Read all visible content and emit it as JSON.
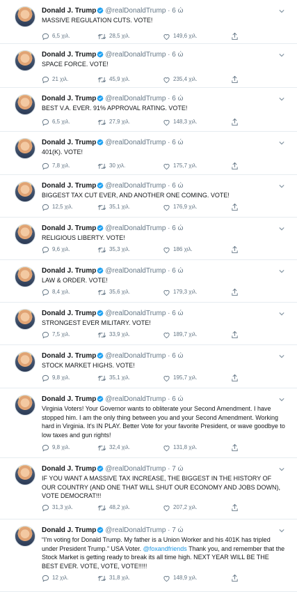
{
  "feed": {
    "tweets": [
      {
        "name": "Donald J. Trump",
        "handle": "@realDonaldTrump",
        "dot": "·",
        "time": "6 ώ",
        "text": "MASSIVE REGULATION CUTS. VOTE!",
        "replies": "6,5 χιλ.",
        "retweets": "28,5 χιλ.",
        "likes": "149,6 χιλ."
      },
      {
        "name": "Donald J. Trump",
        "handle": "@realDonaldTrump",
        "dot": "·",
        "time": "6 ώ",
        "text": "SPACE FORCE. VOTE!",
        "replies": "21 χιλ.",
        "retweets": "45,9 χιλ.",
        "likes": "235,4 χιλ."
      },
      {
        "name": "Donald J. Trump",
        "handle": "@realDonaldTrump",
        "dot": "·",
        "time": "6 ώ",
        "text": "BEST V.A. EVER. 91% APPROVAL RATING. VOTE!",
        "replies": "6,5 χιλ.",
        "retweets": "27,9 χιλ.",
        "likes": "148,3 χιλ."
      },
      {
        "name": "Donald J. Trump",
        "handle": "@realDonaldTrump",
        "dot": "·",
        "time": "6 ώ",
        "text": "401(K). VOTE!",
        "replies": "7,8 χιλ.",
        "retweets": "30 χιλ.",
        "likes": "175,7 χιλ."
      },
      {
        "name": "Donald J. Trump",
        "handle": "@realDonaldTrump",
        "dot": "·",
        "time": "6 ώ",
        "text": "BIGGEST TAX CUT EVER, AND ANOTHER ONE COMING. VOTE!",
        "replies": "12,5 χιλ.",
        "retweets": "35,1 χιλ.",
        "likes": "176,9 χιλ."
      },
      {
        "name": "Donald J. Trump",
        "handle": "@realDonaldTrump",
        "dot": "·",
        "time": "6 ώ",
        "text": "RELIGIOUS LIBERTY. VOTE!",
        "replies": "9,6 χιλ.",
        "retweets": "35,3 χιλ.",
        "likes": "186 χιλ."
      },
      {
        "name": "Donald J. Trump",
        "handle": "@realDonaldTrump",
        "dot": "·",
        "time": "6 ώ",
        "text": "LAW & ORDER. VOTE!",
        "replies": "8,4 χιλ.",
        "retweets": "35,6 χιλ.",
        "likes": "179,3 χιλ."
      },
      {
        "name": "Donald J. Trump",
        "handle": "@realDonaldTrump",
        "dot": "·",
        "time": "6 ώ",
        "text": "STRONGEST EVER MILITARY. VOTE!",
        "replies": "7,5 χιλ.",
        "retweets": "33,9 χιλ.",
        "likes": "189,7 χιλ."
      },
      {
        "name": "Donald J. Trump",
        "handle": "@realDonaldTrump",
        "dot": "·",
        "time": "6 ώ",
        "text": "STOCK MARKET HIGHS. VOTE!",
        "replies": "9,8 χιλ.",
        "retweets": "35,1 χιλ.",
        "likes": "195,7 χιλ."
      },
      {
        "name": "Donald J. Trump",
        "handle": "@realDonaldTrump",
        "dot": "·",
        "time": "6 ώ",
        "text": "Virginia Voters! Your Governor wants to obliterate your Second Amendment. I have stopped him. I am the only thing between you and your Second Amendment. Working hard in Virginia. It's IN PLAY. Better Vote for your favorite President, or wave goodbye to low taxes and gun rights!",
        "replies": "9,8 χιλ.",
        "retweets": "32,4 χιλ.",
        "likes": "131,8 χιλ."
      },
      {
        "name": "Donald J. Trump",
        "handle": "@realDonaldTrump",
        "dot": "·",
        "time": "7 ώ",
        "text": "IF YOU WANT A MASSIVE TAX INCREASE, THE BIGGEST IN THE HISTORY OF OUR COUNTRY (AND ONE THAT WILL SHUT OUR ECONOMY AND JOBS DOWN), VOTE DEMOCRAT!!!",
        "replies": "31,3 χιλ.",
        "retweets": "48,2 χιλ.",
        "likes": "207,2 χιλ."
      },
      {
        "name": "Donald J. Trump",
        "handle": "@realDonaldTrump",
        "dot": "·",
        "time": "7 ώ",
        "text_parts": [
          "“I'm voting for Donald Trump. My father is a Union Worker and his 401K has tripled under President Trump.” USA Voter. ",
          "@foxandfriends",
          " Thank you, and remember that the Stock Market is getting ready to break its all time high. NEXT YEAR WILL BE THE BEST EVER. VOTE, VOTE, VOTE!!!!!"
        ],
        "replies": "12 χιλ.",
        "retweets": "31,8 χιλ.",
        "likes": "148,9 χιλ."
      }
    ]
  },
  "colors": {
    "verified": "#1da1f2",
    "muted": "#657786",
    "link": "#1b95e0",
    "divider": "#e6ecf0"
  },
  "icons": {
    "caret": "chevron-down-icon",
    "reply": "reply-icon",
    "retweet": "retweet-icon",
    "like": "heart-icon",
    "share": "share-icon"
  }
}
